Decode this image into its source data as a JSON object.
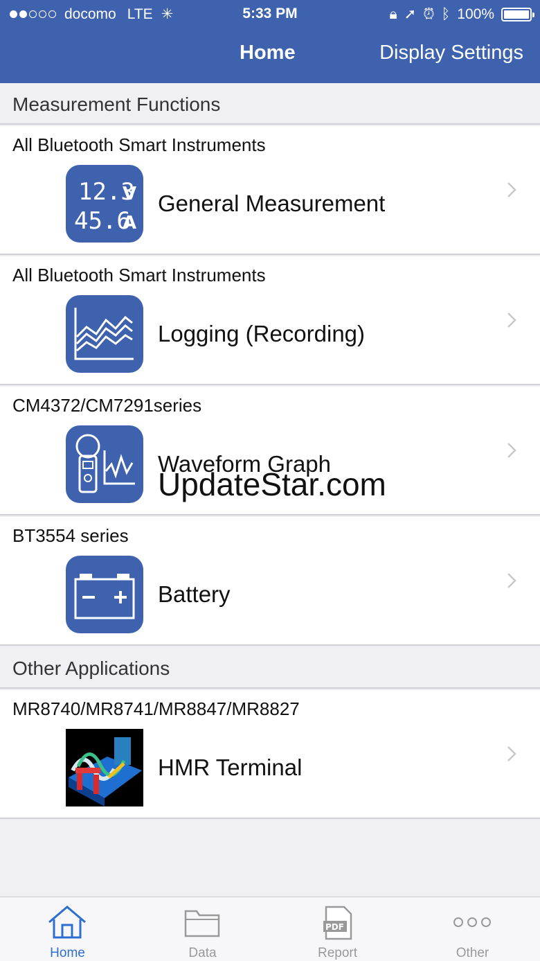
{
  "status": {
    "carrier": "docomo",
    "network": "LTE",
    "time": "5:33 PM",
    "battery": "100%"
  },
  "nav": {
    "title": "Home",
    "settings": "Display Settings"
  },
  "sections": [
    {
      "header": "Measurement Functions"
    },
    {
      "header": "Other Applications"
    }
  ],
  "items": [
    {
      "caption": "All Bluetooth Smart Instruments",
      "title": "General Measurement",
      "icon": "voltage-current-display-icon"
    },
    {
      "caption": "All Bluetooth Smart Instruments",
      "title": "Logging (Recording)",
      "icon": "logging-graph-icon"
    },
    {
      "caption": "CM4372/CM7291series",
      "title": "Waveform Graph",
      "icon": "clamp-meter-waveform-icon"
    },
    {
      "caption": "BT3554 series",
      "title": "Battery",
      "icon": "battery-icon"
    },
    {
      "caption": "MR8740/MR8741/MR8847/MR8827",
      "title": "HMR Terminal",
      "icon": "hmr-terminal-image"
    }
  ],
  "general_icon": {
    "line1": "12.3",
    "unit1": "V",
    "line2": "45.6",
    "unit2": "A"
  },
  "watermark": "UpdateStar.com",
  "tabs": [
    {
      "label": "Home",
      "icon": "home-icon"
    },
    {
      "label": "Data",
      "icon": "folder-icon"
    },
    {
      "label": "Report",
      "icon": "pdf-document-icon"
    },
    {
      "label": "Other",
      "icon": "more-icon"
    }
  ],
  "colors": {
    "primary": "#3f62ae",
    "active_tab": "#2d6fd0",
    "background": "#efeff4"
  }
}
